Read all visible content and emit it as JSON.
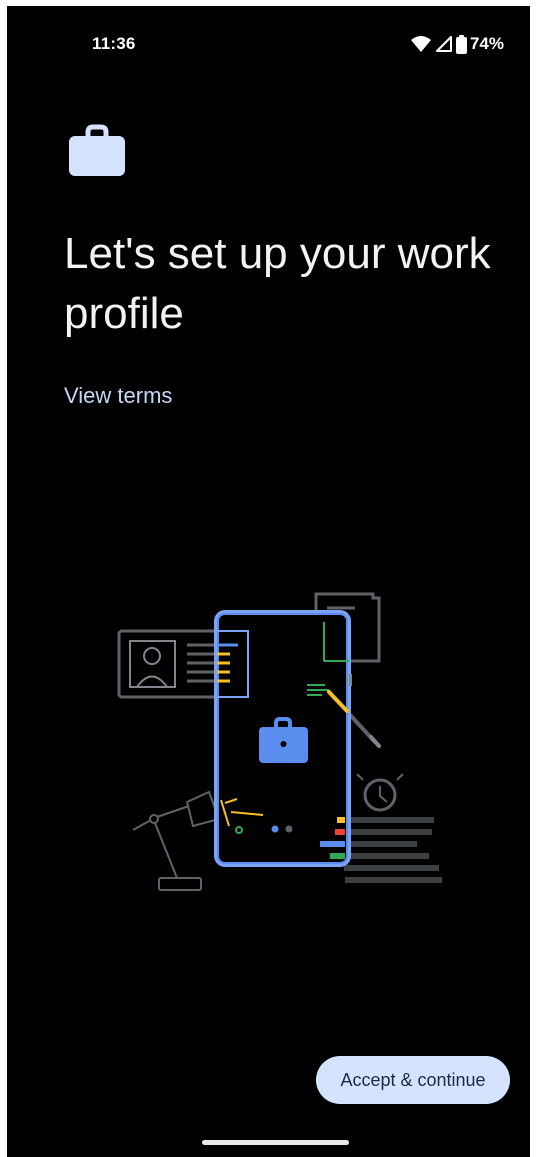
{
  "status_bar": {
    "time": "11:36",
    "battery_percent": "74%",
    "icons": [
      "wifi-icon",
      "cellular-signal-icon",
      "battery-icon"
    ]
  },
  "header": {
    "icon": "briefcase-icon",
    "title": "Let's set up your work profile"
  },
  "links": {
    "view_terms": "View terms"
  },
  "illustration": {
    "name": "work-profile-phone-illustration",
    "colors": {
      "blue": "#5b8def",
      "yellow": "#f6c026",
      "green": "#34a853",
      "red": "#ea4335",
      "gray": "#5f6368"
    }
  },
  "actions": {
    "accept_label": "Accept & continue"
  },
  "colors": {
    "background": "#000000",
    "accent_button": "#d5e3ff",
    "link": "#c4d7f9"
  }
}
